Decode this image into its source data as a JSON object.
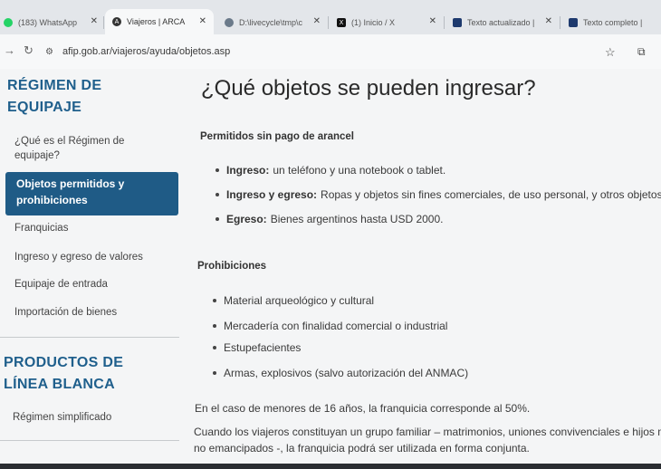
{
  "browser": {
    "tabs": [
      {
        "title": "(183) WhatsApp",
        "icon": "whatsapp-icon",
        "color": "#25d366",
        "glyph": "✆"
      },
      {
        "title": "Viajeros | ARCA",
        "icon": "arca-icon",
        "color": "#333333",
        "glyph": "A"
      },
      {
        "title": "D:\\livecycle\\tmp\\c",
        "icon": "globe-icon",
        "color": "#6b7a8a",
        "glyph": "◉"
      },
      {
        "title": "(1) Inicio / X",
        "icon": "x-icon",
        "color": "#111111",
        "glyph": "X"
      },
      {
        "title": "Texto actualizado |",
        "icon": "doc-icon",
        "color": "#1e3a6e",
        "glyph": "▣"
      },
      {
        "title": "Texto completo | ",
        "icon": "doc-icon",
        "color": "#1e3a6e",
        "glyph": "▣"
      }
    ],
    "url": "afip.gob.ar/viajeros/ayuda/objetos.asp"
  },
  "sidebar": {
    "heading1": [
      "RÉGIMEN DE",
      "EQUIPAJE"
    ],
    "items": [
      {
        "label": "¿Qué es el Régimen de equipaje?"
      },
      {
        "label": "Objetos permitidos y prohibiciones",
        "active": true
      },
      {
        "label": "Franquicias"
      },
      {
        "label": "Ingreso y egreso de valores"
      },
      {
        "label": "Equipaje de entrada"
      },
      {
        "label": "Importación de bienes"
      }
    ],
    "heading2": [
      "PRODUCTOS DE",
      "LÍNEA BLANCA"
    ],
    "items2": [
      {
        "label": "Régimen simplificado"
      }
    ]
  },
  "main": {
    "title": "¿Qué objetos se pueden ingresar?",
    "permitidos_title": "Permitidos sin pago de arancel",
    "permitidos": [
      {
        "bold": "Ingreso:",
        "text": "un teléfono y una notebook o tablet."
      },
      {
        "bold": "Ingreso y egreso:",
        "text": "Ropas y objetos sin fines comerciales, de uso personal, y otros objetos"
      },
      {
        "bold": "Egreso:",
        "text": "Bienes argentinos hasta USD 2000."
      }
    ],
    "prohibiciones_title": "Prohibiciones",
    "prohibiciones": [
      "Material arqueológico y cultural",
      "Mercadería con finalidad comercial o industrial",
      "Estupefacientes",
      "Armas, explosivos (salvo autorización del ANMAC)"
    ],
    "para1": "En el caso de menores de 16 años, la franquicia corresponde al 50%.",
    "para2_line1": "Cuando los viajeros constituyan un grupo familiar – matrimonios, uniones convivenciales e hijos m",
    "para2_line2": "no emancipados -, la franquicia podrá ser utilizada en forma conjunta."
  },
  "colors": {
    "accent": "#1f5b86",
    "heading": "#1f5f8c"
  }
}
